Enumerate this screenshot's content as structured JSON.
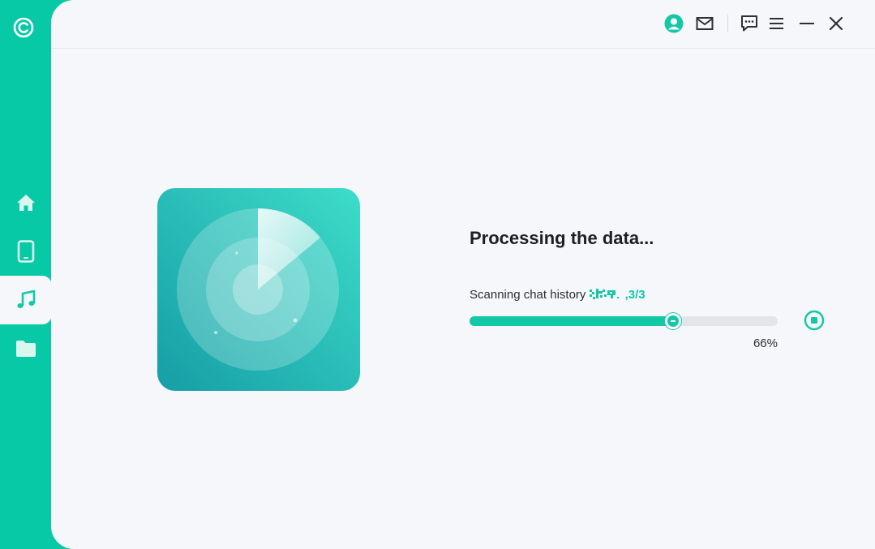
{
  "sidebar": {
    "logo_icon": "app-logo-icon",
    "items": [
      {
        "icon": "home-icon"
      },
      {
        "icon": "phone-icon"
      },
      {
        "icon": "music-icon",
        "active": true
      },
      {
        "icon": "folder-icon"
      }
    ]
  },
  "titlebar": {
    "icons": [
      "account-icon",
      "mail-icon",
      "feedback-icon",
      "menu-icon",
      "minimize-icon",
      "close-icon"
    ]
  },
  "main": {
    "title": "Processing the data...",
    "status_text": "Scanning chat history ",
    "status_counter": ",3/3",
    "progress": {
      "value": 66,
      "label": "66%"
    }
  },
  "colors": {
    "accent": "#07c9a5",
    "background": "#f5f7fa",
    "text": "#1d1f22"
  }
}
